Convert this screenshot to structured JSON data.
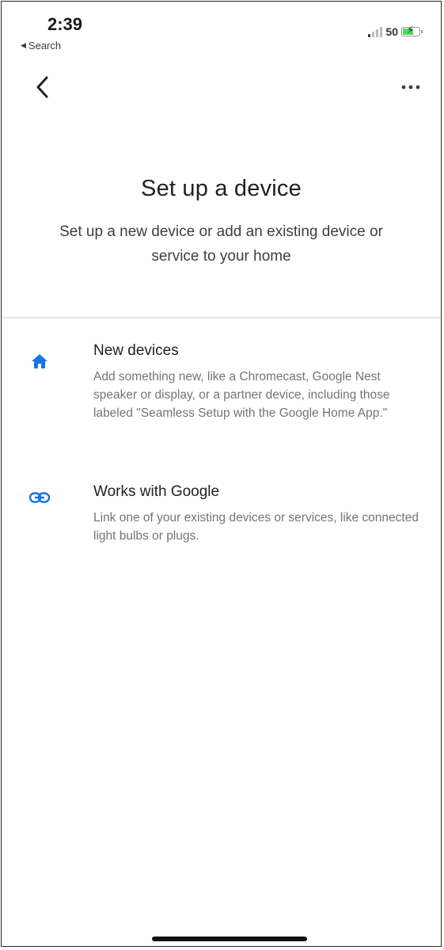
{
  "status_bar": {
    "time": "2:39",
    "back_app": "Search",
    "network": "50",
    "icons": [
      "signal-icon",
      "battery-charging-icon"
    ]
  },
  "app_bar": {
    "back_icon": "chevron-left-icon",
    "more_icon": "more-horizontal-icon"
  },
  "header": {
    "title": "Set up a device",
    "subtitle": "Set up a new device or add an existing device or service to your home"
  },
  "options": [
    {
      "icon": "home-icon",
      "title": "New devices",
      "description": "Add something new, like a Chromecast, Google Nest speaker or display, or a partner device, including those labeled \"Seamless Setup with the Google Home App.\""
    },
    {
      "icon": "link-icon",
      "title": "Works with Google",
      "description": "Link one of your existing devices or services, like connected light bulbs or plugs."
    }
  ],
  "colors": {
    "accent": "#1a73e8",
    "title_text": "#202124",
    "secondary_text": "#70757a",
    "divider": "#e6e6e6"
  }
}
